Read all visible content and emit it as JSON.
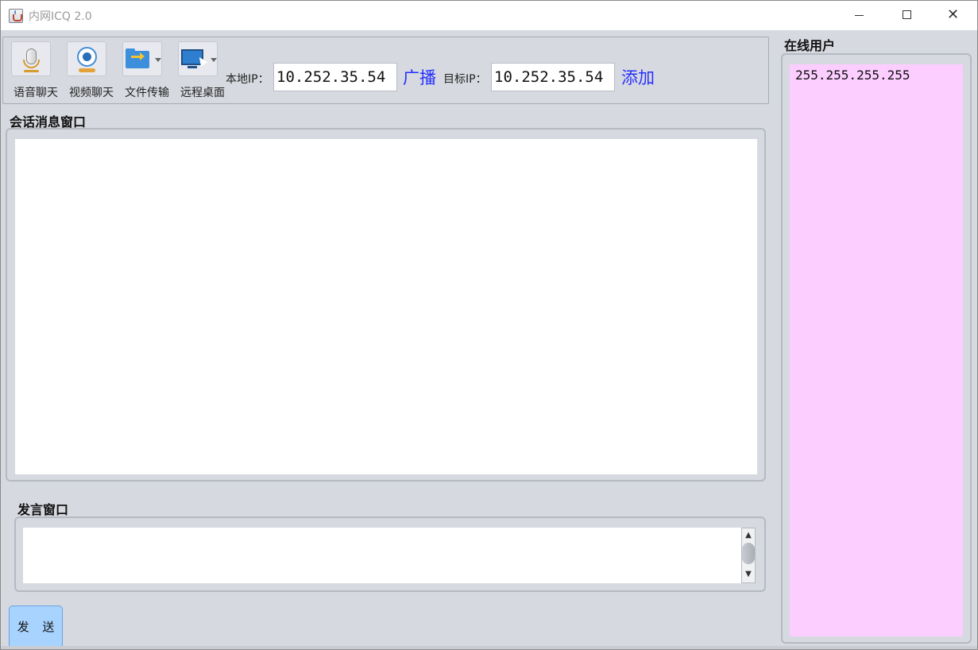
{
  "window": {
    "title": "内网ICQ 2.0",
    "minimize_icon": "minimize-icon",
    "maximize_icon": "maximize-icon",
    "close_icon": "close-icon"
  },
  "toolbar": {
    "buttons": [
      {
        "label": "语音聊天",
        "icon": "microphone-icon"
      },
      {
        "label": "视频聊天",
        "icon": "webcam-icon"
      },
      {
        "label": "文件传输",
        "icon": "folder-transfer-icon"
      },
      {
        "label": "远程桌面",
        "icon": "remote-desktop-icon"
      }
    ],
    "local_ip_label": "本地IP：",
    "local_ip_value": "10.252.35.54",
    "broadcast_label": "广播",
    "target_ip_label": "目标IP：",
    "target_ip_value": "10.252.35.54",
    "add_label": "添加"
  },
  "chat": {
    "title": "会话消息窗口"
  },
  "compose": {
    "title": "发言窗口",
    "value": ""
  },
  "send": {
    "label": "发 送"
  },
  "online": {
    "title": "在线用户",
    "users": [
      "255.255.255.255"
    ]
  },
  "colors": {
    "background": "#d6d9df",
    "online_list_bg": "#fccdff",
    "send_button_bg": "#a8d3ff",
    "link_color": "#2630ff"
  }
}
